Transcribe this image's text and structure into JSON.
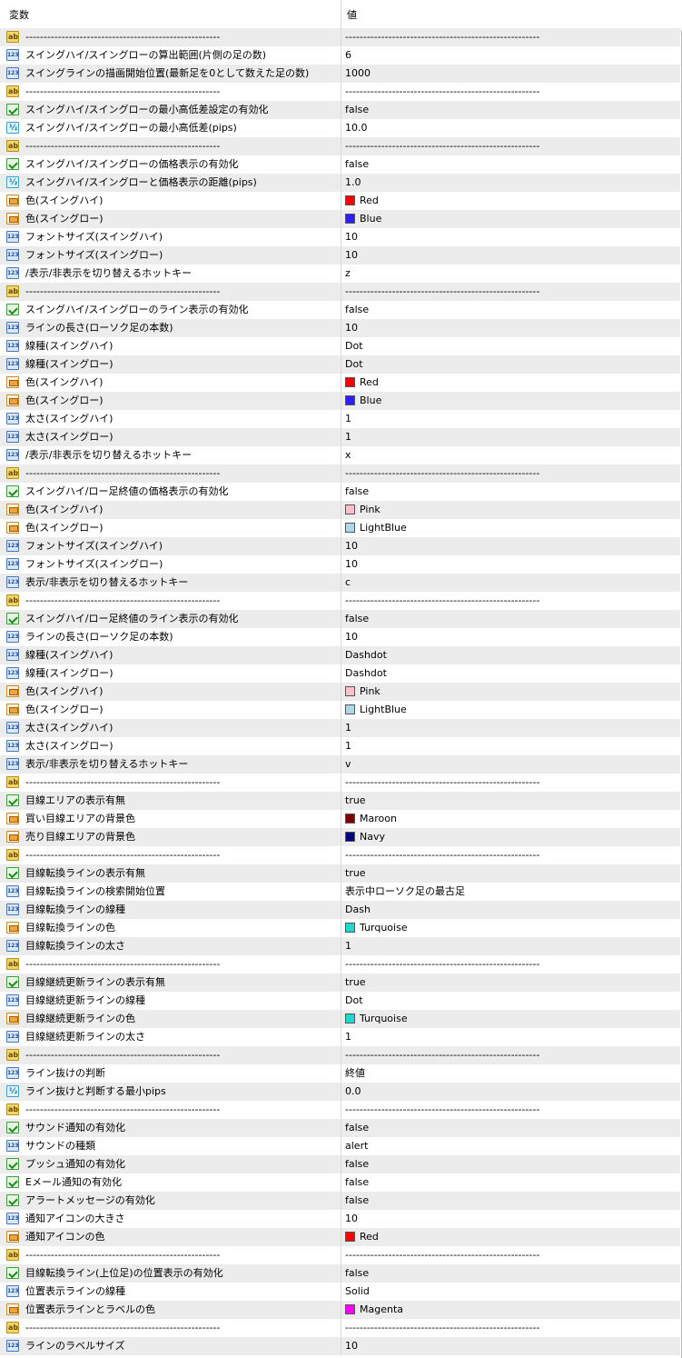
{
  "header": {
    "name_col": "変数",
    "value_col": "値"
  },
  "rows": [
    {
      "icon": "ab",
      "name": "------------------------------------------------------",
      "value": "------------------------------------------------------"
    },
    {
      "icon": "123",
      "name": "スイングハイ/スイングローの算出範囲(片側の足の数)",
      "value": "6"
    },
    {
      "icon": "123",
      "name": "スイングラインの描画開始位置(最新足を0として数えた足の数)",
      "value": "1000"
    },
    {
      "icon": "ab",
      "name": "------------------------------------------------------",
      "value": "------------------------------------------------------"
    },
    {
      "icon": "bool",
      "name": "スイングハイ/スイングローの最小高低差設定の有効化",
      "value": "false"
    },
    {
      "icon": "dbl",
      "name": "スイングハイ/スイングローの最小高低差(pips)",
      "value": "10.0"
    },
    {
      "icon": "ab",
      "name": "------------------------------------------------------",
      "value": "------------------------------------------------------"
    },
    {
      "icon": "bool",
      "name": "スイングハイ/スイングローの価格表示の有効化",
      "value": "false"
    },
    {
      "icon": "dbl",
      "name": "スイングハイ/スイングローと価格表示の距離(pips)",
      "value": "1.0"
    },
    {
      "icon": "color",
      "name": "色(スイングハイ)",
      "value": "Red",
      "swatch": "#ff0000"
    },
    {
      "icon": "color",
      "name": "色(スイングロー)",
      "value": "Blue",
      "swatch": "#2f1cff"
    },
    {
      "icon": "123",
      "name": "フォントサイズ(スイングハイ)",
      "value": "10"
    },
    {
      "icon": "123",
      "name": "フォントサイズ(スイングロー)",
      "value": "10"
    },
    {
      "icon": "123",
      "name": "/表示/非表示を切り替えるホットキー",
      "value": "z"
    },
    {
      "icon": "ab",
      "name": "------------------------------------------------------",
      "value": "------------------------------------------------------"
    },
    {
      "icon": "bool",
      "name": "スイングハイ/スイングローのライン表示の有効化",
      "value": "false"
    },
    {
      "icon": "123",
      "name": "ラインの長さ(ローソク足の本数)",
      "value": "10"
    },
    {
      "icon": "123",
      "name": "線種(スイングハイ)",
      "value": "Dot"
    },
    {
      "icon": "123",
      "name": "線種(スイングロー)",
      "value": "Dot"
    },
    {
      "icon": "color",
      "name": "色(スイングハイ)",
      "value": "Red",
      "swatch": "#ff0000"
    },
    {
      "icon": "color",
      "name": "色(スイングロー)",
      "value": "Blue",
      "swatch": "#2f1cff"
    },
    {
      "icon": "123",
      "name": "太さ(スイングハイ)",
      "value": "1"
    },
    {
      "icon": "123",
      "name": "太さ(スイングロー)",
      "value": "1"
    },
    {
      "icon": "123",
      "name": "/表示/非表示を切り替えるホットキー",
      "value": "x"
    },
    {
      "icon": "ab",
      "name": "------------------------------------------------------",
      "value": "------------------------------------------------------"
    },
    {
      "icon": "bool",
      "name": "スイングハイ/ロー足終値の価格表示の有効化",
      "value": "false"
    },
    {
      "icon": "color",
      "name": "色(スイングハイ)",
      "value": "Pink",
      "swatch": "#ffc0cb"
    },
    {
      "icon": "color",
      "name": "色(スイングロー)",
      "value": "LightBlue",
      "swatch": "#add8e6"
    },
    {
      "icon": "123",
      "name": "フォントサイズ(スイングハイ)",
      "value": "10"
    },
    {
      "icon": "123",
      "name": "フォントサイズ(スイングロー)",
      "value": "10"
    },
    {
      "icon": "123",
      "name": "表示/非表示を切り替えるホットキー",
      "value": "c"
    },
    {
      "icon": "ab",
      "name": "------------------------------------------------------",
      "value": "------------------------------------------------------"
    },
    {
      "icon": "bool",
      "name": "スイングハイ/ロー足終値のライン表示の有効化",
      "value": "false"
    },
    {
      "icon": "123",
      "name": "ラインの長さ(ローソク足の本数)",
      "value": "10"
    },
    {
      "icon": "123",
      "name": "線種(スイングハイ)",
      "value": "Dashdot"
    },
    {
      "icon": "123",
      "name": "線種(スイングロー)",
      "value": "Dashdot"
    },
    {
      "icon": "color",
      "name": "色(スイングハイ)",
      "value": "Pink",
      "swatch": "#ffc0cb"
    },
    {
      "icon": "color",
      "name": "色(スイングロー)",
      "value": "LightBlue",
      "swatch": "#add8e6"
    },
    {
      "icon": "123",
      "name": "太さ(スイングハイ)",
      "value": "1"
    },
    {
      "icon": "123",
      "name": "太さ(スイングロー)",
      "value": "1"
    },
    {
      "icon": "123",
      "name": "表示/非表示を切り替えるホットキー",
      "value": "v"
    },
    {
      "icon": "ab",
      "name": "------------------------------------------------------",
      "value": "------------------------------------------------------"
    },
    {
      "icon": "bool",
      "name": "目線エリアの表示有無",
      "value": "true"
    },
    {
      "icon": "color",
      "name": "買い目線エリアの背景色",
      "value": "Maroon",
      "swatch": "#800000"
    },
    {
      "icon": "color",
      "name": "売り目線エリアの背景色",
      "value": "Navy",
      "swatch": "#000080"
    },
    {
      "icon": "ab",
      "name": "------------------------------------------------------",
      "value": "------------------------------------------------------"
    },
    {
      "icon": "bool",
      "name": "目線転換ラインの表示有無",
      "value": "true"
    },
    {
      "icon": "123",
      "name": "目線転換ラインの検索開始位置",
      "value": "表示中ローソク足の最古足"
    },
    {
      "icon": "123",
      "name": "目線転換ラインの線種",
      "value": "Dash"
    },
    {
      "icon": "color",
      "name": "目線転換ラインの色",
      "value": "Turquoise",
      "swatch": "#20d8d0"
    },
    {
      "icon": "123",
      "name": "目線転換ラインの太さ",
      "value": "1"
    },
    {
      "icon": "ab",
      "name": "------------------------------------------------------",
      "value": "------------------------------------------------------"
    },
    {
      "icon": "bool",
      "name": "目線継続更新ラインの表示有無",
      "value": "true"
    },
    {
      "icon": "123",
      "name": "目線継続更新ラインの線種",
      "value": "Dot"
    },
    {
      "icon": "color",
      "name": "目線継続更新ラインの色",
      "value": "Turquoise",
      "swatch": "#20d8d0"
    },
    {
      "icon": "123",
      "name": "目線継続更新ラインの太さ",
      "value": "1"
    },
    {
      "icon": "ab",
      "name": "------------------------------------------------------",
      "value": "------------------------------------------------------"
    },
    {
      "icon": "123",
      "name": "ライン抜けの判断",
      "value": "終値"
    },
    {
      "icon": "dbl",
      "name": "ライン抜けと判断する最小pips",
      "value": "0.0"
    },
    {
      "icon": "ab",
      "name": "------------------------------------------------------",
      "value": "------------------------------------------------------"
    },
    {
      "icon": "bool",
      "name": "サウンド通知の有効化",
      "value": "false"
    },
    {
      "icon": "123",
      "name": "サウンドの種類",
      "value": "alert"
    },
    {
      "icon": "bool",
      "name": "プッシュ通知の有効化",
      "value": "false"
    },
    {
      "icon": "bool",
      "name": "Eメール通知の有効化",
      "value": "false"
    },
    {
      "icon": "bool",
      "name": "アラートメッセージの有効化",
      "value": "false"
    },
    {
      "icon": "123",
      "name": "通知アイコンの大きさ",
      "value": "10"
    },
    {
      "icon": "color",
      "name": "通知アイコンの色",
      "value": "Red",
      "swatch": "#ff0000"
    },
    {
      "icon": "ab",
      "name": "------------------------------------------------------",
      "value": "------------------------------------------------------"
    },
    {
      "icon": "bool",
      "name": "目線転換ライン(上位足)の位置表示の有効化",
      "value": "false"
    },
    {
      "icon": "123",
      "name": "位置表示ラインの線種",
      "value": "Solid"
    },
    {
      "icon": "color",
      "name": "位置表示ラインとラベルの色",
      "value": "Magenta",
      "swatch": "#ff00ff"
    },
    {
      "icon": "ab",
      "name": "------------------------------------------------------",
      "value": "------------------------------------------------------"
    },
    {
      "icon": "123",
      "name": "ラインのラベルサイズ",
      "value": "10"
    }
  ]
}
